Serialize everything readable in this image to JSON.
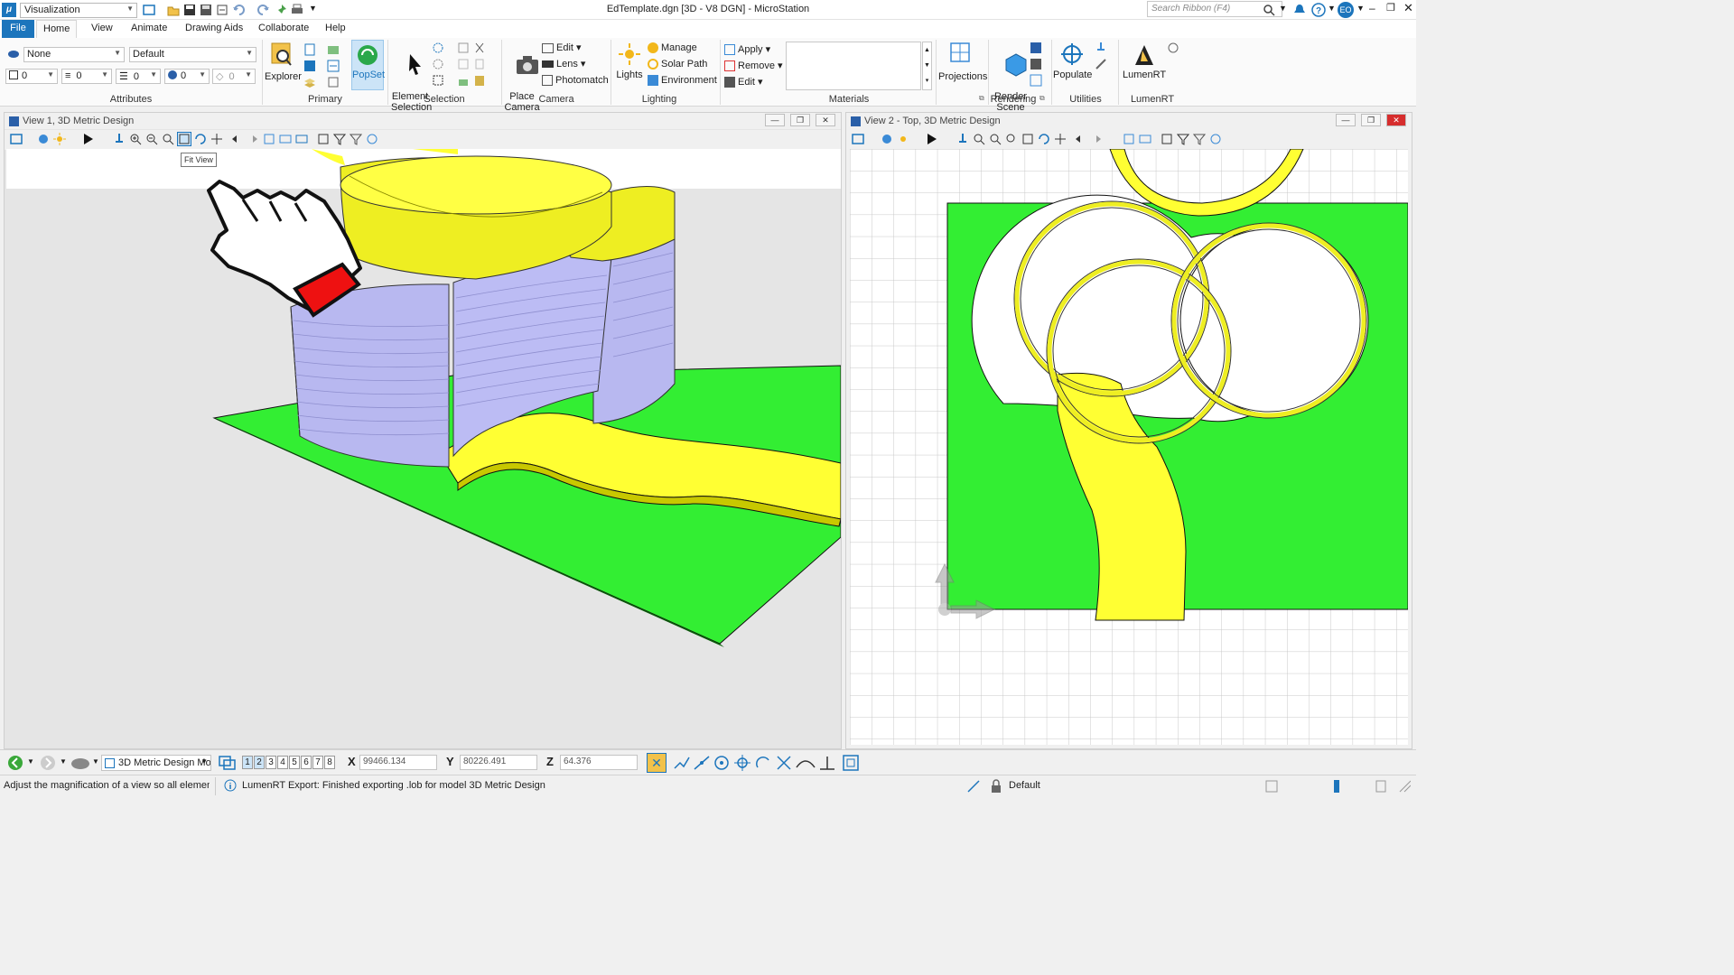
{
  "app": {
    "title": "EdTemplate.dgn [3D - V8 DGN] - MicroStation",
    "workflow": "Visualization",
    "search_placeholder": "Search Ribbon (F4)",
    "user": "EO"
  },
  "tabs": [
    "File",
    "Home",
    "View",
    "Animate",
    "Drawing Aids",
    "Collaborate",
    "Help"
  ],
  "attributes": {
    "level": "None",
    "style": "Default",
    "color": "0",
    "weight": "0",
    "linestyle": "0",
    "transparency": "0",
    "priority": "0",
    "label": "Attributes"
  },
  "primary": {
    "explorer": "Explorer",
    "popset": "PopSet",
    "label": "Primary"
  },
  "selection": {
    "element": "Element\nSelection",
    "label": "Selection"
  },
  "camera": {
    "place": "Place\nCamera",
    "edit": "Edit",
    "lens": "Lens",
    "photomatch": "Photomatch",
    "label": "Camera"
  },
  "lighting": {
    "lights": "Lights",
    "manage": "Manage",
    "solar": "Solar Path",
    "environment": "Environment",
    "label": "Lighting"
  },
  "materials": {
    "apply": "Apply",
    "remove": "Remove",
    "edit": "Edit",
    "label": "Materials"
  },
  "projections": {
    "label_btn": "Projections"
  },
  "rendering": {
    "render": "Render\nScene",
    "label": "Rendering"
  },
  "utilities": {
    "populate": "Populate",
    "label": "Utilities"
  },
  "lumenrt": {
    "btn": "LumenRT",
    "label": "LumenRT"
  },
  "view1": {
    "title": "View 1, 3D Metric Design",
    "tooltip": "Fit View"
  },
  "view2": {
    "title": "View 2 - Top, 3D Metric Design"
  },
  "status": {
    "model": "3D Metric Design Mo",
    "views": [
      "1",
      "2",
      "3",
      "4",
      "5",
      "6",
      "7",
      "8"
    ],
    "x_label": "X",
    "x": "99466.134",
    "y_label": "Y",
    "y": "80226.491",
    "z_label": "Z",
    "z": "64.376",
    "prompt": "Adjust the magnification of a view so all elements ar",
    "message": "LumenRT Export: Finished exporting .lob for model 3D Metric Design",
    "level_display": "Default"
  },
  "colors": {
    "accent": "#1c75bc",
    "ground": "#33ee33",
    "path": "#ffff33",
    "walls": "#b8b8f0"
  }
}
